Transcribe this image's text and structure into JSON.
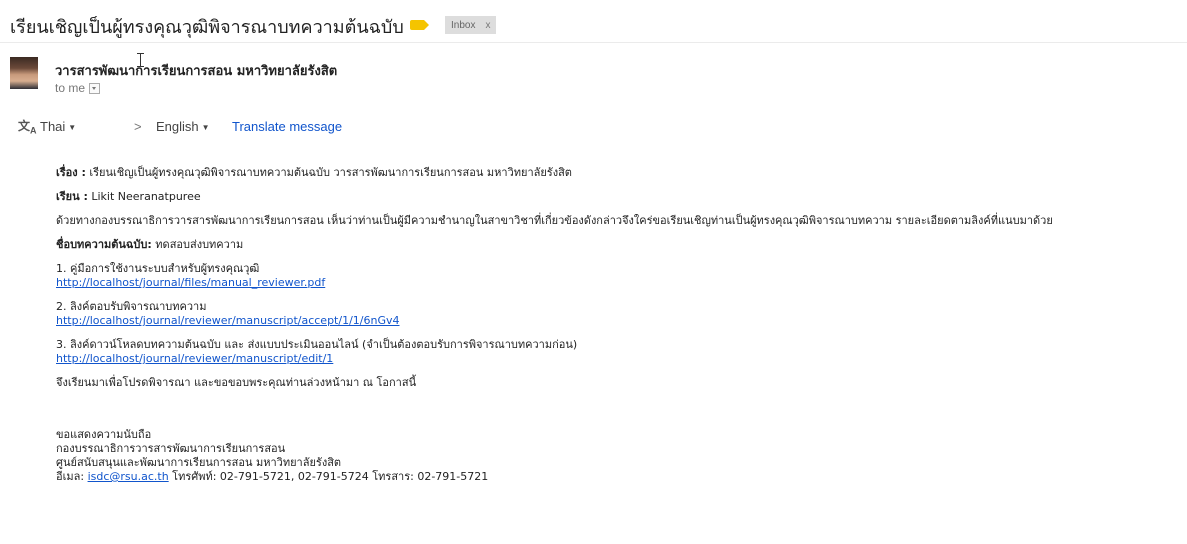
{
  "header": {
    "subject": "เรียนเชิญเป็นผู้ทรงคุณวุฒิพิจารณาบทความต้นฉบับ",
    "label_color": "#f5c400",
    "inbox_chip": "Inbox",
    "inbox_close": "x"
  },
  "message": {
    "sender": "วารสารพัฒนาการเรียนการสอน มหาวิทยาลัยรังสิต",
    "to": "to me"
  },
  "translate": {
    "icon": "translate-icon",
    "from_lang": "Thai",
    "arrow": ">",
    "to_lang": "English",
    "action": "Translate message"
  },
  "body": {
    "subject_label": "เรื่อง :",
    "subject_text": " เรียนเชิญเป็นผู้ทรงคุณวุฒิพิจารณาบทความต้นฉบับ วารสารพัฒนาการเรียนการสอน มหาวิทยาลัยรังสิต",
    "dear_label": "เรียน :",
    "dear_text": " Likit Neeranatpuree",
    "intro": "ด้วยทางกองบรรณาธิการวารสารพัฒนาการเรียนการสอน เห็นว่าท่านเป็นผู้มีความชำนาญในสาขาวิชาที่เกี่ยวข้องดังกล่าวจึงใคร่ขอเรียนเชิญท่านเป็นผู้ทรงคุณวุฒิพิจารณาบทความ รายละเอียดตามลิงค์ที่แนบมาด้วย",
    "article_label": "ชื่อบทความต้นฉบับ:",
    "article_text": " ทดสอบส่งบทความ",
    "items": [
      {
        "title": "1. คู่มือการใช้งานระบบสำหรับผู้ทรงคุณวุฒิ",
        "link": "http://localhost/journal/files/manual_reviewer.pdf"
      },
      {
        "title": "2. ลิงค์ตอบรับพิจารณาบทความ",
        "link": "http://localhost/journal/reviewer/manuscript/accept/1/1/6nGv4"
      },
      {
        "title": "3. ลิงค์ดาวน์โหลดบทความต้นฉบับ และ ส่งแบบประเมินออนไลน์ (จำเป็นต้องตอบรับการพิจารณาบทความก่อน)",
        "link": "http://localhost/journal/reviewer/manuscript/edit/1"
      }
    ],
    "closing": "จึงเรียนมาเพื่อโปรดพิจารณา และขอขอบพระคุณท่านล่วงหน้ามา ณ โอกาสนี้",
    "sig_1": "ขอแสดงความนับถือ",
    "sig_2": "กองบรรณาธิการวารสารพัฒนาการเรียนการสอน",
    "sig_3": "ศูนย์สนับสนุนและพัฒนาการเรียนการสอน มหาวิทยาลัยรังสิต",
    "sig_email_label": "อีเมล: ",
    "sig_email": "isdc@rsu.ac.th",
    "sig_phone": " โทรศัพท์: 02-791-5721, 02-791-5724 โทรสาร: 02-791-5721"
  }
}
